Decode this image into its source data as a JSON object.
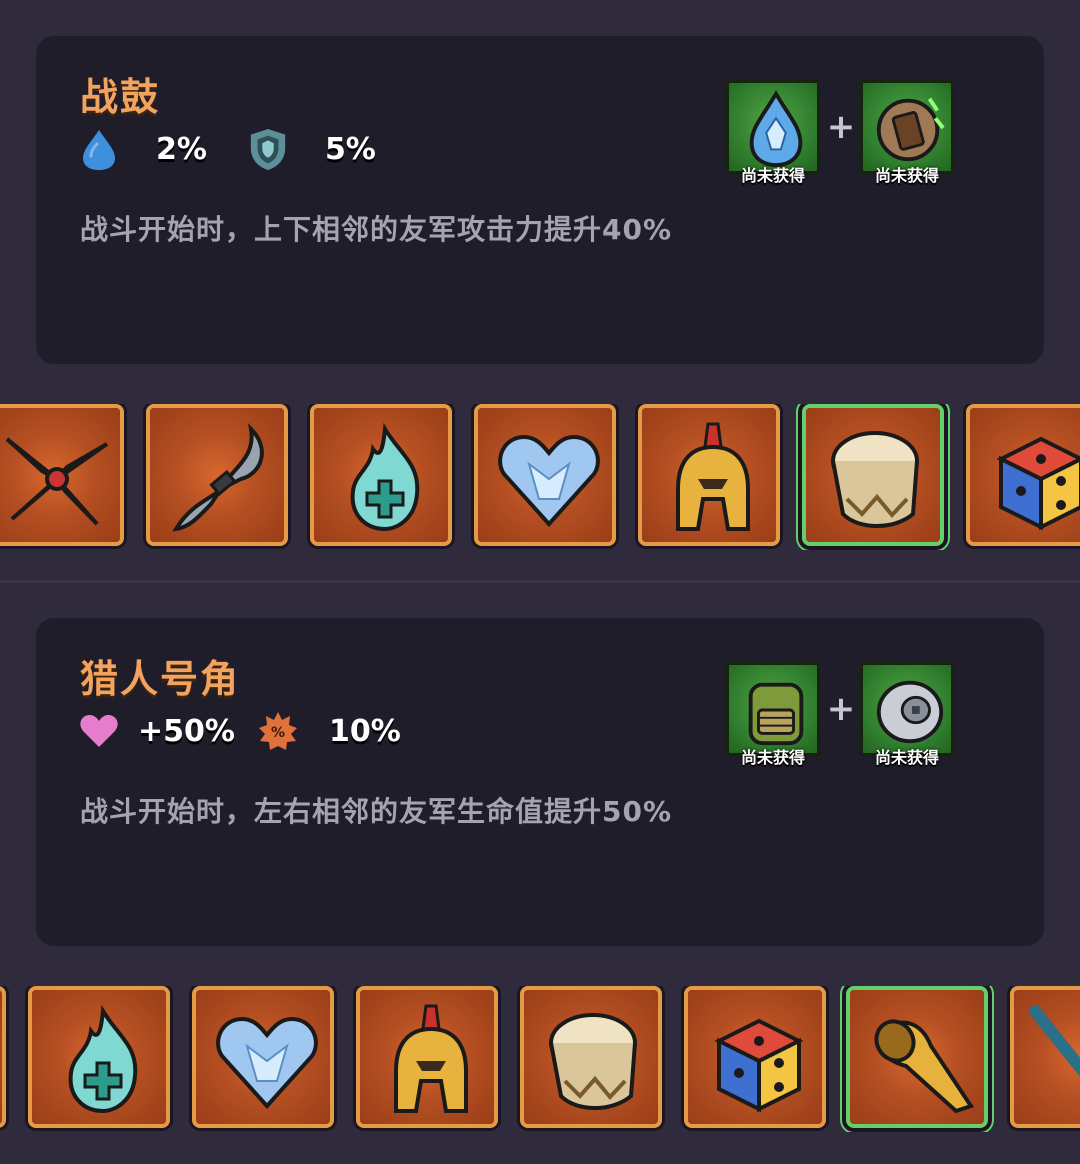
{
  "cards": [
    {
      "title": "战鼓",
      "stats": [
        {
          "icon": "water-drop-icon",
          "value": "2%"
        },
        {
          "icon": "shield-icon",
          "value": "5%"
        }
      ],
      "description": "战斗开始时，上下相邻的友军攻击力提升40%",
      "recipe": {
        "items": [
          {
            "icon": "blue-crystal-drop-icon",
            "status": "尚未获得"
          },
          {
            "icon": "wooden-shield-icon",
            "status": "尚未获得"
          }
        ],
        "plus": "+"
      },
      "items": [
        {
          "icon": "shuriken-icon"
        },
        {
          "icon": "double-blade-icon"
        },
        {
          "icon": "healing-flame-icon"
        },
        {
          "icon": "crystal-heart-icon"
        },
        {
          "icon": "spartan-helmet-icon"
        },
        {
          "icon": "war-drum-icon",
          "selected": true
        },
        {
          "icon": "dice-icon"
        }
      ]
    },
    {
      "title": "猎人号角",
      "stats": [
        {
          "icon": "heart-icon",
          "value": "+50%"
        },
        {
          "icon": "crit-percent-icon",
          "value": "10%"
        }
      ],
      "description": "战斗开始时，左右相邻的友军生命值提升50%",
      "recipe": {
        "items": [
          {
            "icon": "backpack-icon",
            "status": "尚未获得"
          },
          {
            "icon": "silver-disc-icon",
            "status": "尚未获得"
          }
        ],
        "plus": "+"
      },
      "items": [
        {
          "icon": "partial-tile-icon"
        },
        {
          "icon": "healing-flame-icon"
        },
        {
          "icon": "crystal-heart-icon"
        },
        {
          "icon": "spartan-helmet-icon"
        },
        {
          "icon": "war-drum-icon"
        },
        {
          "icon": "dice-icon"
        },
        {
          "icon": "hunter-horn-icon",
          "selected": true
        },
        {
          "icon": "flower-staff-icon"
        }
      ]
    }
  ]
}
